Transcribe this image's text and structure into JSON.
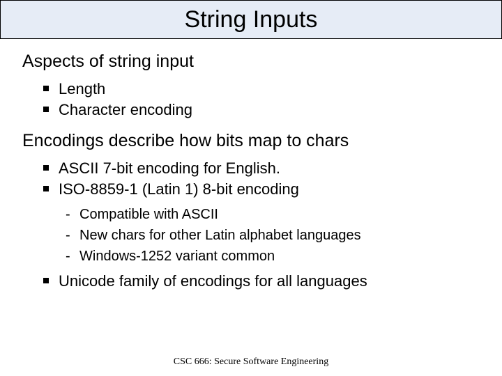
{
  "title": "String Inputs",
  "sections": [
    {
      "heading": "Aspects of string input",
      "bullets": [
        {
          "text": "Length"
        },
        {
          "text": "Character encoding"
        }
      ]
    },
    {
      "heading": "Encodings describe how bits map to chars",
      "bullets": [
        {
          "text": "ASCII 7-bit encoding for English."
        },
        {
          "text": "ISO-8859-1 (Latin 1) 8-bit encoding",
          "sub": [
            "Compatible with ASCII",
            "New chars for other Latin alphabet languages",
            "Windows-1252 variant common"
          ]
        },
        {
          "text": "Unicode family of encodings for all languages"
        }
      ]
    }
  ],
  "footer": "CSC 666: Secure Software Engineering"
}
